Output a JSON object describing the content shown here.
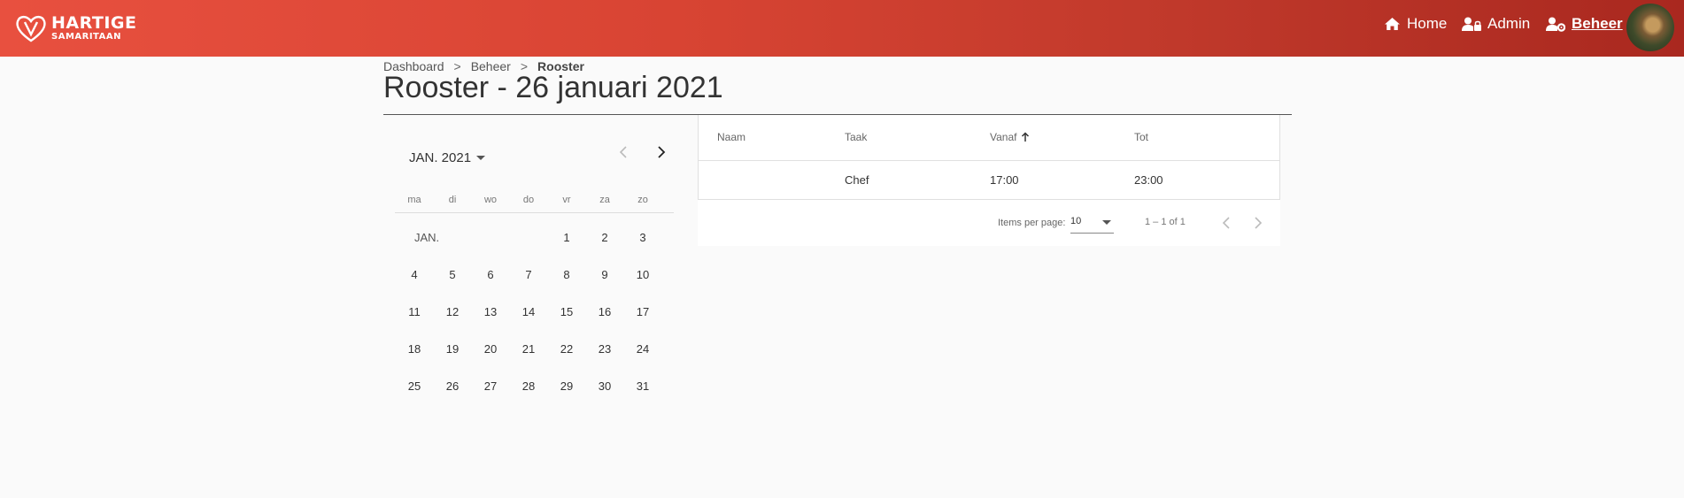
{
  "header": {
    "logo": {
      "line1": "HARTIGE",
      "line2": "SAMARITAAN",
      "icon": "heart-hands-icon"
    },
    "nav": [
      {
        "label": "Home",
        "icon": "home-icon"
      },
      {
        "label": "Admin",
        "icon": "user-lock-icon"
      },
      {
        "label": "Beheer",
        "icon": "user-cog-icon",
        "active": true
      }
    ],
    "avatar": "avatar-dog-photo"
  },
  "breadcrumb": [
    "Dashboard",
    "Beheer",
    "Rooster"
  ],
  "breadcrumb_separator": ">",
  "page_title": "Rooster - 26 januari 2021",
  "calendar": {
    "period_label": "JAN. 2021",
    "weekdays": [
      "ma",
      "di",
      "wo",
      "do",
      "vr",
      "za",
      "zo"
    ],
    "month_label": "JAN.",
    "days": [
      "1",
      "2",
      "3",
      "4",
      "5",
      "6",
      "7",
      "8",
      "9",
      "10",
      "11",
      "12",
      "13",
      "14",
      "15",
      "16",
      "17",
      "18",
      "19",
      "20",
      "21",
      "22",
      "23",
      "24",
      "25",
      "26",
      "27",
      "28",
      "29",
      "30",
      "31"
    ],
    "first_weekday_index": 4,
    "prev_icon": "chevron-left-icon",
    "next_icon": "chevron-right-icon"
  },
  "table": {
    "columns": [
      "Naam",
      "Taak",
      "Vanaf",
      "Tot"
    ],
    "sort_column": "Vanaf",
    "sort_icon": "arrow-up-icon",
    "rows": [
      {
        "naam": "",
        "taak": "Chef",
        "vanaf": "17:00",
        "tot": "23:00"
      }
    ]
  },
  "paginator": {
    "items_per_page_label": "Items per page:",
    "items_per_page": "10",
    "range_label": "1 – 1 of 1"
  },
  "colors": {
    "header_start": "#e8503f",
    "header_end": "#a9281f",
    "background": "#fafafa"
  }
}
